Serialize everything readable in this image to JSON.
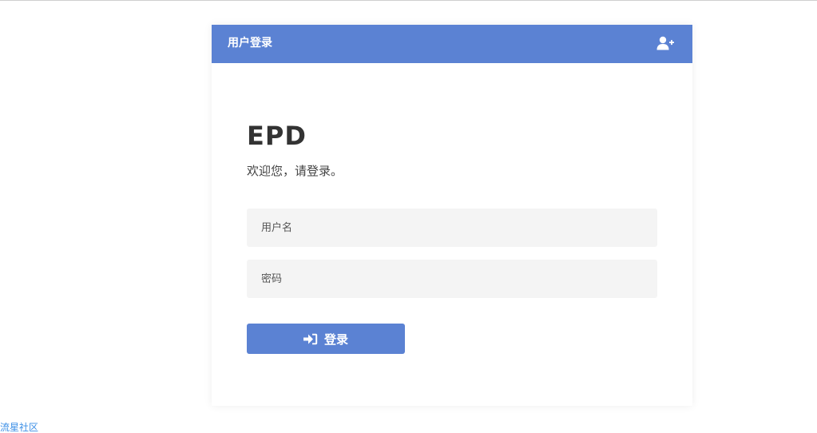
{
  "card": {
    "title": "用户登录",
    "header_icon": "user-plus-icon"
  },
  "brand": "EPD",
  "welcome": "欢迎您，请登录。",
  "form": {
    "username_placeholder": "用户名",
    "password_placeholder": "密码",
    "login_label": "登录",
    "login_icon": "sign-in-icon"
  },
  "footer": {
    "link_text": "流星社区"
  },
  "colors": {
    "accent": "#5b82d3",
    "link": "#3a8ee6",
    "input_bg": "#f4f4f4"
  }
}
